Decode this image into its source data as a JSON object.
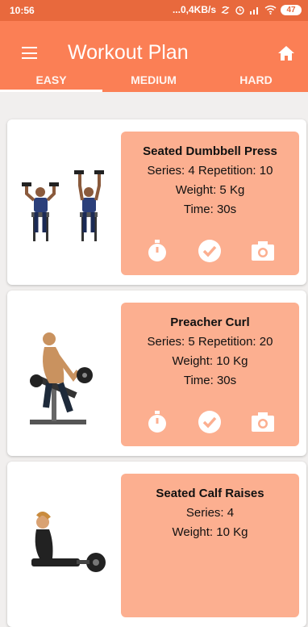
{
  "status": {
    "time": "10:56",
    "network": "...0,4KB/s",
    "battery": "47"
  },
  "appbar": {
    "title": "Workout Plan"
  },
  "tabs": [
    {
      "label": "EASY"
    },
    {
      "label": "MEDIUM"
    },
    {
      "label": "HARD"
    }
  ],
  "exercises": [
    {
      "name": "Seated Dumbbell Press",
      "line1": "Series: 4 Repetition: 10",
      "line2": "Weight: 5 Kg",
      "line3": "Time: 30s"
    },
    {
      "name": "Preacher Curl",
      "line1": "Series: 5 Repetition: 20",
      "line2": "Weight: 10 Kg",
      "line3": "Time: 30s"
    },
    {
      "name": "Seated Calf Raises",
      "line1": "Series: 4",
      "line2": "Weight: 10 Kg"
    }
  ],
  "icons": {
    "timer": "stopwatch-icon",
    "done": "check-circle-icon",
    "photo": "camera-icon"
  },
  "colors": {
    "statusbar": "#e8693d",
    "appbar": "#fb7f55",
    "info_card": "#fcaf90"
  }
}
